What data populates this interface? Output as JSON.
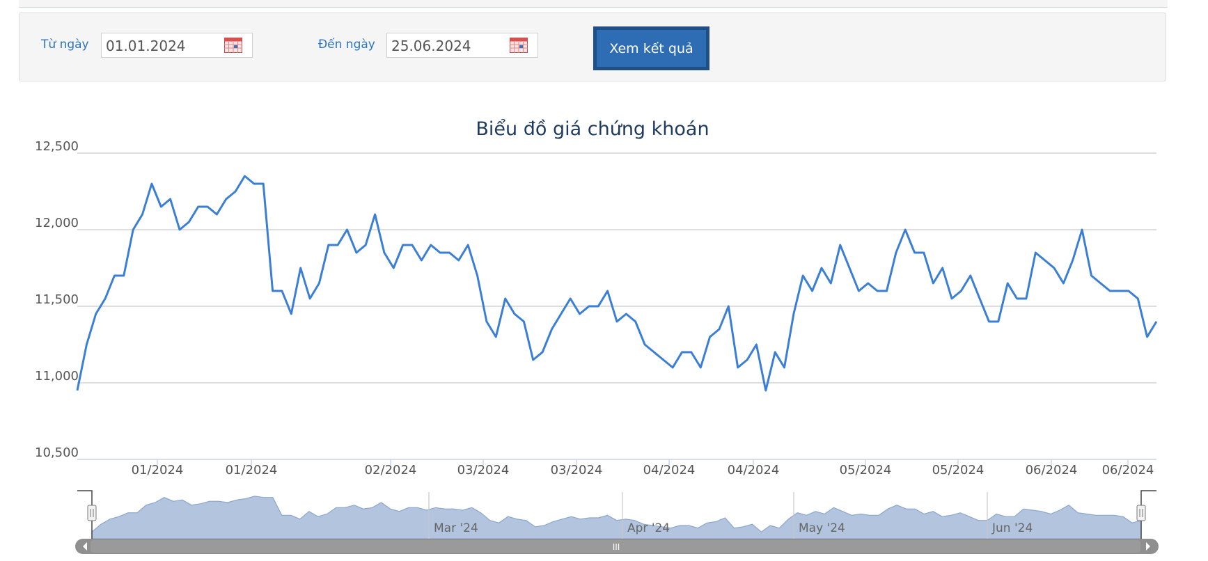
{
  "filter": {
    "from_label": "Từ ngày",
    "from_value": "01.01.2024",
    "to_label": "Đến ngày",
    "to_value": "25.06.2024",
    "submit_label": "Xem kết quả"
  },
  "colors": {
    "line": "#3a7fd5",
    "label_blue": "#2a74c0",
    "button": "#2e6db3",
    "button_border": "#1f4f86",
    "navigator_fill": "#b3c4de",
    "scrollbar": "#8f8f8f"
  },
  "icons": {
    "from_calendar": "calendar-icon",
    "to_calendar": "calendar-icon"
  },
  "chart_data": {
    "type": "line",
    "title": "Biểu đồ giá chứng khoán",
    "ylim": [
      10500,
      12500
    ],
    "yticks": [
      12500,
      12000,
      11500,
      11000,
      10500
    ],
    "ytick_labels": [
      "12,500",
      "12,000",
      "11,500",
      "11,000",
      "10,500"
    ],
    "grid": true,
    "xtick_labels": [
      "01/2024",
      "01/2024",
      "02/2024",
      "03/2024",
      "03/2024",
      "04/2024",
      "04/2024",
      "05/2024",
      "05/2024",
      "06/2024",
      "06/2024"
    ],
    "navigator_labels": [
      "Mar '24",
      "Apr '24",
      "May '24",
      "Jun '24"
    ],
    "scrollbar_grip": "III",
    "series": [
      {
        "values": [
          10950,
          11250,
          11450,
          11550,
          11700,
          11700,
          12000,
          12100,
          12300,
          12150,
          12200,
          12000,
          12050,
          12150,
          12150,
          12100,
          12200,
          12250,
          12350,
          12300,
          12300,
          11600,
          11600,
          11450,
          11750,
          11550,
          11650,
          11900,
          11900,
          12000,
          11850,
          11900,
          12100,
          11850,
          11750,
          11900,
          11900,
          11800,
          11900,
          11850,
          11850,
          11800,
          11900,
          11700,
          11400,
          11300,
          11550,
          11450,
          11400,
          11150,
          11200,
          11350,
          11450,
          11550,
          11450,
          11500,
          11500,
          11600,
          11400,
          11450,
          11400,
          11250,
          11200,
          11150,
          11100,
          11200,
          11200,
          11100,
          11300,
          11350,
          11500,
          11100,
          11150,
          11250,
          10950,
          11200,
          11100,
          11450,
          11700,
          11600,
          11750,
          11650,
          11900,
          11750,
          11600,
          11650,
          11600,
          11600,
          11850,
          12000,
          11850,
          11850,
          11650,
          11750,
          11550,
          11600,
          11700,
          11550,
          11400,
          11400,
          11650,
          11550,
          11550,
          11850,
          11800,
          11750,
          11650,
          11800,
          12000,
          11700,
          11650,
          11600,
          11600,
          11600,
          11550,
          11300,
          11400
        ]
      }
    ]
  }
}
